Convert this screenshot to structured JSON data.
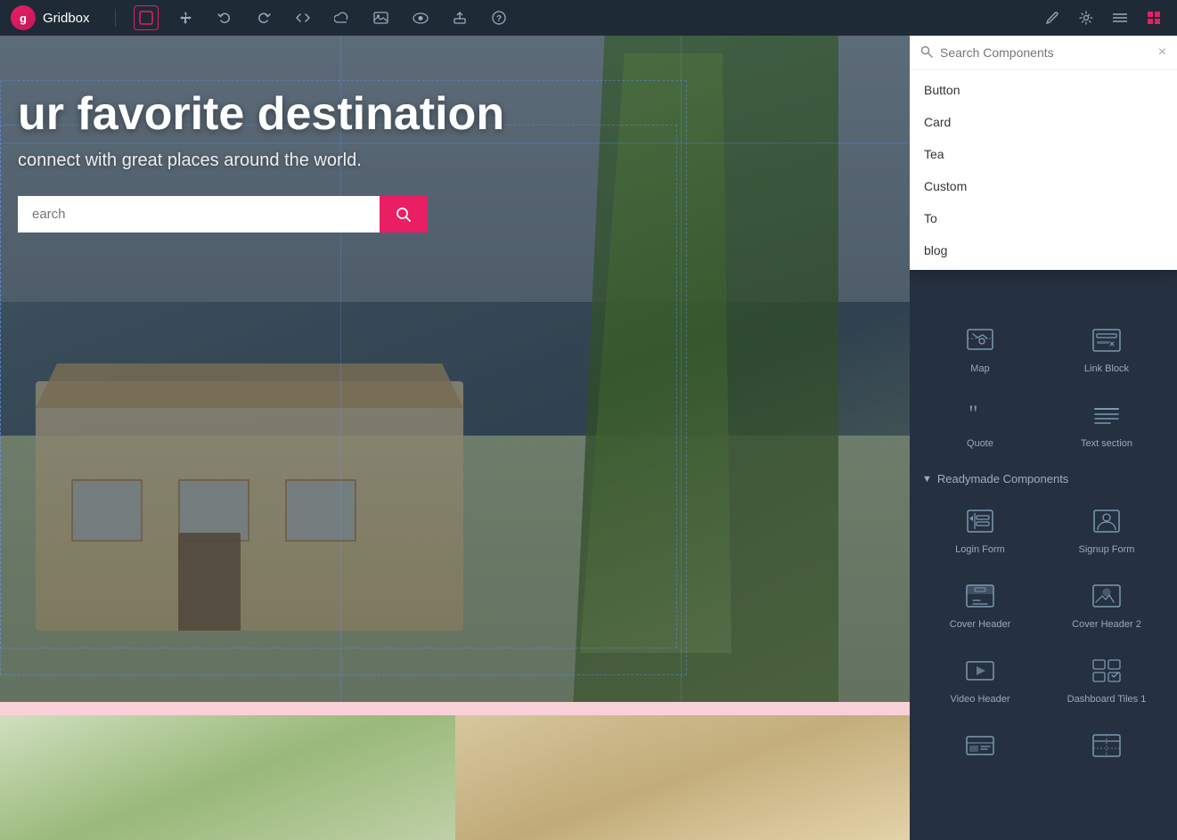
{
  "app": {
    "name": "Gridbox",
    "logo_letter": "g"
  },
  "toolbar": {
    "icons": [
      "□",
      "✥",
      "↺",
      "↻",
      "</>",
      "☁",
      "🖼",
      "👁",
      "💾",
      "?"
    ],
    "right_icons": [
      "✏",
      "⚙",
      "☰"
    ]
  },
  "search": {
    "placeholder": "Search Components",
    "clear_label": "×",
    "results": [
      {
        "id": "button",
        "label": "Button"
      },
      {
        "id": "card",
        "label": "Card"
      },
      {
        "id": "tea",
        "label": "Tea"
      },
      {
        "id": "custom",
        "label": "Custom"
      },
      {
        "id": "to",
        "label": "To"
      },
      {
        "id": "blog",
        "label": "blog"
      }
    ]
  },
  "panel": {
    "basic_components": [
      {
        "id": "map",
        "label": "Map",
        "icon": "map"
      },
      {
        "id": "link-block",
        "label": "Link Block",
        "icon": "linkblock"
      },
      {
        "id": "quote",
        "label": "Quote",
        "icon": "quote"
      },
      {
        "id": "text-section",
        "label": "Text section",
        "icon": "textsection"
      }
    ],
    "readymade_section_label": "Readymade Components",
    "readymade_components": [
      {
        "id": "login-form",
        "label": "Login Form",
        "icon": "loginform"
      },
      {
        "id": "signup-form",
        "label": "Signup Form",
        "icon": "signupform"
      },
      {
        "id": "cover-header",
        "label": "Cover Header",
        "icon": "coverheader"
      },
      {
        "id": "cover-header-2",
        "label": "Cover Header 2",
        "icon": "coverheader2"
      },
      {
        "id": "video-header",
        "label": "Video Header",
        "icon": "videoheader"
      },
      {
        "id": "dashboard-tiles-1",
        "label": "Dashboard Tiles 1",
        "icon": "dashboard"
      },
      {
        "id": "generic-1",
        "label": "",
        "icon": "generic1"
      },
      {
        "id": "generic-2",
        "label": "",
        "icon": "generic2"
      }
    ]
  },
  "canvas": {
    "hero_title": "ur favorite destination",
    "hero_subtitle": "connect with great places around the world.",
    "search_placeholder": "earch",
    "search_btn_icon": "🔍"
  }
}
